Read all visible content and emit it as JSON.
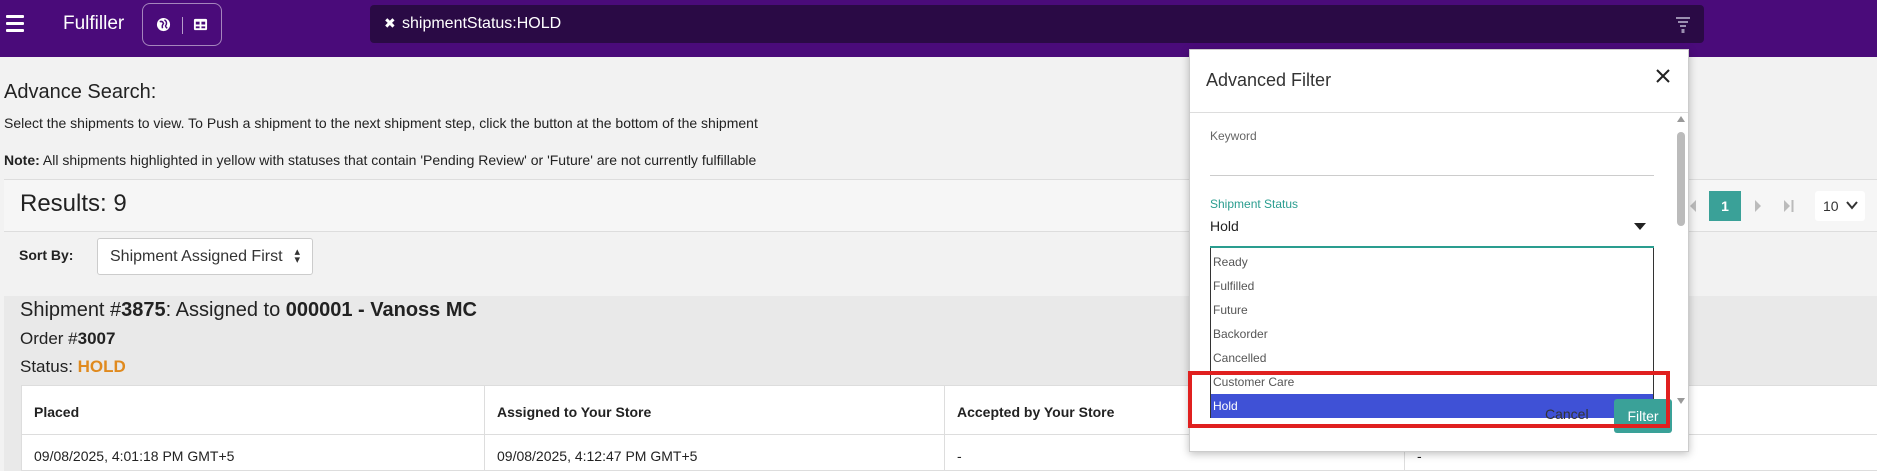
{
  "app": {
    "title": "Fulfiller"
  },
  "search": {
    "chip_text": "shipmentStatus:HOLD"
  },
  "page": {
    "heading": "Advance Search:",
    "description": "Select the shipments to view. To Push a shipment to the next shipment step, click the button at the bottom of the shipment",
    "note_label": "Note:",
    "note_text": " All shipments highlighted in yellow with statuses that contain 'Pending Review' or 'Future' are not currently fulfillable",
    "results": "Results: 9",
    "sort_label": "Sort By:",
    "sort_value": "Shipment Assigned First"
  },
  "pagination": {
    "current": "1",
    "page_size": "10"
  },
  "shipment": {
    "title_prefix": "Shipment #",
    "number": "3875",
    "assigned_prefix": ": Assigned to ",
    "assignee": "000001 - Vanoss MC",
    "order_prefix": "Order #",
    "order_number": "3007",
    "status_prefix": "Status: ",
    "status_value": "HOLD",
    "columns": [
      "Placed",
      "Assigned to Your Store",
      "Accepted by Your Store",
      ""
    ],
    "row": [
      "09/08/2025, 4:01:18 PM GMT+5",
      "09/08/2025, 4:12:47 PM GMT+5",
      "-",
      "-"
    ]
  },
  "modal": {
    "title": "Advanced Filter",
    "keyword_label": "Keyword",
    "keyword_value": "",
    "status_label": "Shipment Status",
    "status_value": "Hold",
    "options": [
      "Ready",
      "Fulfilled",
      "Future",
      "Backorder",
      "Cancelled",
      "Customer Care",
      "Hold"
    ],
    "selected_option": "Hold",
    "cancel_label": "Cancel",
    "filter_label": "Filter"
  },
  "colors": {
    "topbar": "#4a0b7a",
    "accent_teal": "#3aa198",
    "status_hold": "#e08a1e",
    "selected_option": "#3f51d6",
    "highlight": "#e0201f"
  },
  "icons": [
    "menu-icon",
    "globe-icon",
    "table-icon",
    "close-icon",
    "filter-icon",
    "chevron-down-icon",
    "first-page-icon",
    "prev-page-icon",
    "next-page-icon",
    "last-page-icon"
  ]
}
